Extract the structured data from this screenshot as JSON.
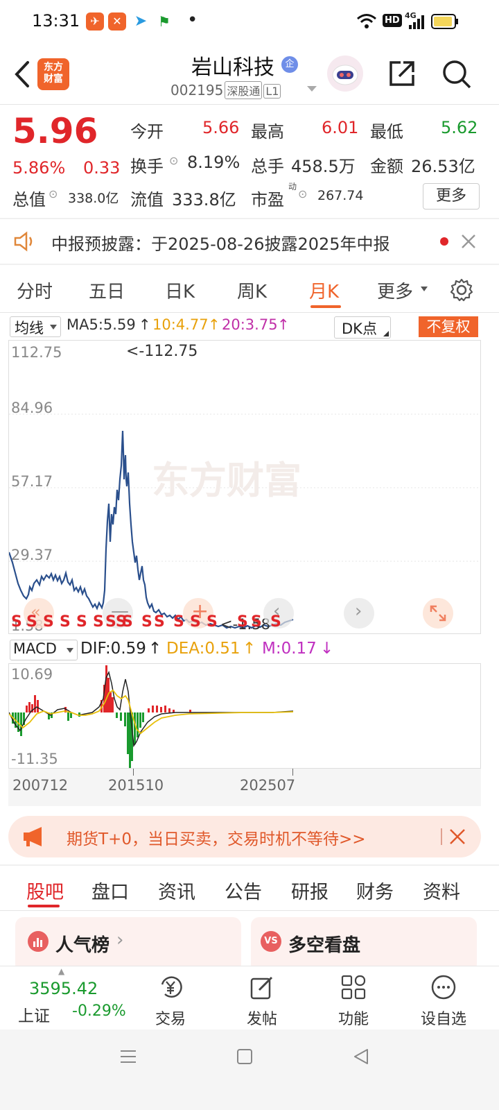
{
  "status_bar": {
    "time": "13:31",
    "dot": "•",
    "hd": "HD",
    "network": "4G"
  },
  "header": {
    "logo_text_1": "东方",
    "logo_text_2": "财富",
    "stock_name": "岩山科技",
    "badge": "企",
    "stock_code": "002195",
    "tag_1": "深股通",
    "tag_2": "L1"
  },
  "quote": {
    "price": "5.96",
    "change_pct": "5.86%",
    "change": "0.33",
    "open_label": "今开",
    "open_value": "5.66",
    "high_label": "最高",
    "high_value": "6.01",
    "low_label": "最低",
    "low_value": "5.62",
    "turnover_label": "换手",
    "turnover_value": "8.19%",
    "volume_label": "总手",
    "volume_value": "458.5万",
    "amount_label": "金额",
    "amount_value": "26.53亿",
    "mcap_label": "总值",
    "mcap_value": "338.0亿",
    "float_label": "流值",
    "float_value": "333.8亿",
    "pe_label": "市盈",
    "pe_sup": "动",
    "pe_value": "267.74",
    "more_label": "更多"
  },
  "notice": {
    "text": "中报预披露：于2025-08-26披露2025年中报"
  },
  "kline_tabs": [
    {
      "label": "分时"
    },
    {
      "label": "五日"
    },
    {
      "label": "日K"
    },
    {
      "label": "周K"
    },
    {
      "label": "月K"
    },
    {
      "label": "更多"
    }
  ],
  "ma_row": {
    "select_label": "均线",
    "ma5": "MA5:5.59",
    "ma10": "10:4.77",
    "ma20": "20:3.75",
    "dk_label": "DK点",
    "fuquan_label": "不复权"
  },
  "price_chart": {
    "y_labels": [
      "112.75",
      "84.96",
      "57.17",
      "29.37",
      "1.58"
    ],
    "max_marker": "<-112.75",
    "min_marker": "<-1.58",
    "signal_marks": [
      "S",
      "S",
      "S",
      "S",
      "S",
      "S",
      "SS",
      "S",
      "S",
      "S",
      "S",
      "S",
      "S",
      "S",
      "S",
      "S",
      "S",
      "S"
    ],
    "watermark": "东方财富"
  },
  "macd_row": {
    "select_label": "MACD",
    "dif": "DIF:0.59",
    "dea": "DEA:0.51",
    "m": "M:0.17"
  },
  "macd_chart": {
    "y_labels": [
      "10.69",
      "-11.35"
    ],
    "x_labels": [
      "200712",
      "201510",
      "202507"
    ]
  },
  "ad": {
    "text": "期货T+0，当日买卖，交易时机不等待>>"
  },
  "bottom_tabs": [
    {
      "label": "股吧"
    },
    {
      "label": "盘口"
    },
    {
      "label": "资讯"
    },
    {
      "label": "公告"
    },
    {
      "label": "研报"
    },
    {
      "label": "财务"
    },
    {
      "label": "资料"
    }
  ],
  "cards": {
    "left_title": "人气榜",
    "right_title": "多空看盘"
  },
  "bottom_nav": {
    "index_value": "3595.42",
    "index_name": "上证",
    "index_change": "-0.29%",
    "trade": "交易",
    "post": "发帖",
    "functions": "功能",
    "watchlist": "设自选"
  },
  "colors": {
    "brand": "#f0642b",
    "up": "#e0262a",
    "down": "#1a9a2e",
    "line": "#2a4f8c"
  }
}
